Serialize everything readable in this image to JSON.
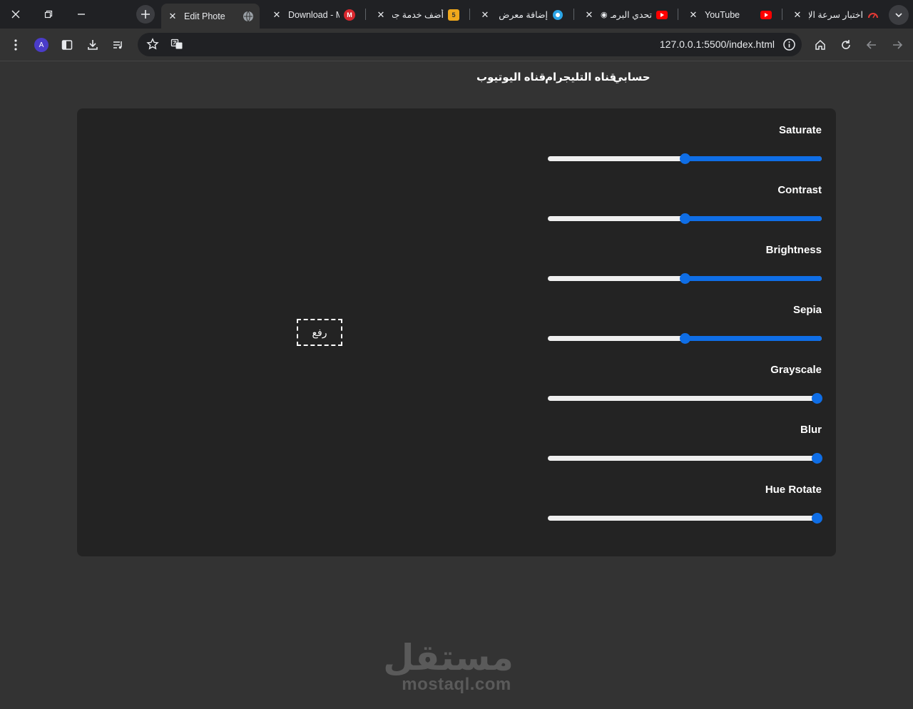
{
  "tabs": [
    {
      "title": "Edit Phote",
      "active": true,
      "favicon": "globe-icon"
    },
    {
      "title": "Download - M",
      "active": false,
      "favicon": "mega-icon"
    },
    {
      "title": "أضف خدمة جد",
      "active": false,
      "favicon": "khamsat-icon"
    },
    {
      "title": "إضافة معرض",
      "active": false,
      "favicon": "mostaql-icon"
    },
    {
      "title": "تحدي البرمـ",
      "active": false,
      "favicon": "youtube-icon"
    },
    {
      "title": "YouTube",
      "active": false,
      "favicon": "youtube-icon"
    },
    {
      "title": "اختبار سرعة الإ",
      "active": false,
      "favicon": "speedtest-icon"
    }
  ],
  "toolbar": {
    "url": "127.0.0.1:5500/index.html",
    "avatar_letter": "A"
  },
  "nav": {
    "account": "حسابي",
    "telegram": "قناه التليجرام",
    "youtube": "قناه اليوتيوب"
  },
  "upload_label": "رفع",
  "filters": [
    {
      "label": "Saturate",
      "value": 0.5
    },
    {
      "label": "Contrast",
      "value": 0.5
    },
    {
      "label": "Brightness",
      "value": 0.5
    },
    {
      "label": "Sepia",
      "value": 0.5
    },
    {
      "label": "Grayscale",
      "value": 1.0
    },
    {
      "label": "Blur",
      "value": 1.0
    },
    {
      "label": "Hue Rotate",
      "value": 1.0
    }
  ],
  "watermark": {
    "logo": "مستقل",
    "domain": "mostaql.com"
  },
  "colors": {
    "accent": "#0f6ee6",
    "page_bg": "#333333",
    "panel_bg": "#232323"
  }
}
